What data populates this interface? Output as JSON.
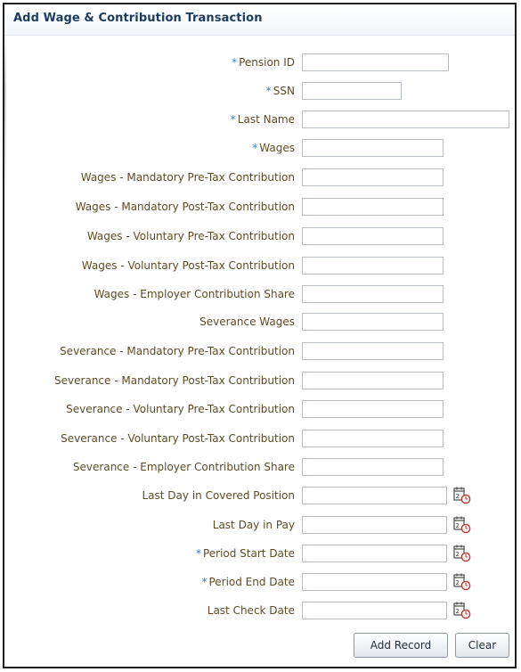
{
  "form": {
    "title": "Add Wage & Contribution Transaction",
    "required_marker": "*",
    "fields": [
      {
        "label": "Pension ID",
        "required": true,
        "value": "",
        "type": "text"
      },
      {
        "label": "SSN",
        "required": true,
        "value": "",
        "type": "text"
      },
      {
        "label": "Last Name",
        "required": true,
        "value": "",
        "type": "text"
      },
      {
        "label": "Wages",
        "required": true,
        "value": "",
        "type": "text"
      },
      {
        "label": "Wages - Mandatory Pre-Tax Contribution",
        "required": false,
        "value": "",
        "type": "text"
      },
      {
        "label": "Wages - Mandatory Post-Tax Contribution",
        "required": false,
        "value": "",
        "type": "text"
      },
      {
        "label": "Wages - Voluntary Pre-Tax Contribution",
        "required": false,
        "value": "",
        "type": "text"
      },
      {
        "label": "Wages - Voluntary Post-Tax Contribution",
        "required": false,
        "value": "",
        "type": "text"
      },
      {
        "label": "Wages - Employer Contribution Share",
        "required": false,
        "value": "",
        "type": "text"
      },
      {
        "label": "Severance Wages",
        "required": false,
        "value": "",
        "type": "text"
      },
      {
        "label": "Severance - Mandatory Pre-Tax Contribution",
        "required": false,
        "value": "",
        "type": "text"
      },
      {
        "label": "Severance - Mandatory Post-Tax Contribution",
        "required": false,
        "value": "",
        "type": "text"
      },
      {
        "label": "Severance - Voluntary Pre-Tax Contribution",
        "required": false,
        "value": "",
        "type": "text"
      },
      {
        "label": "Severance - Voluntary Post-Tax Contribution",
        "required": false,
        "value": "",
        "type": "text"
      },
      {
        "label": "Severance - Employer Contribution Share",
        "required": false,
        "value": "",
        "type": "text"
      },
      {
        "label": "Last Day in Covered Position",
        "required": false,
        "value": "",
        "type": "date",
        "icon": "calendar-clock-icon"
      },
      {
        "label": "Last Day in Pay",
        "required": false,
        "value": "",
        "type": "date",
        "icon": "calendar-clock-icon"
      },
      {
        "label": "Period Start Date",
        "required": true,
        "value": "",
        "type": "date",
        "icon": "calendar-clock-icon"
      },
      {
        "label": "Period End Date",
        "required": true,
        "value": "",
        "type": "date",
        "icon": "calendar-clock-icon"
      },
      {
        "label": "Last Check Date",
        "required": false,
        "value": "",
        "type": "date",
        "icon": "calendar-clock-icon"
      }
    ],
    "buttons": {
      "add_record": "Add Record",
      "clear": "Clear"
    }
  },
  "colors": {
    "title": "#1c3c5e",
    "label": "#5e4b25",
    "required_marker": "#2c7ed6",
    "input_border": "#b7bdc6",
    "panel_border": "#1f1f1f"
  }
}
